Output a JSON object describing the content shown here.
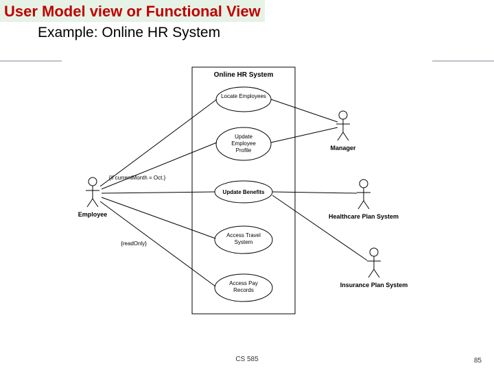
{
  "title": "User Model view or Functional View",
  "subtitle": "Example: Online HR System",
  "footer_course": "CS 585",
  "footer_page": "85",
  "diagram": {
    "system_name": "Online HR System",
    "actors": {
      "employee": "Employee",
      "manager": "Manager",
      "healthcare": "Healthcare Plan System",
      "insurance": "Insurance Plan System"
    },
    "usecases": {
      "uc1": "Locate Employees",
      "uc2_l1": "Update",
      "uc2_l2": "Employee",
      "uc2_l3": "Profile",
      "uc3": "Update Benefits",
      "uc4_l1": "Access Travel",
      "uc4_l2": "System",
      "uc5_l1": "Access Pay",
      "uc5_l2": "Records"
    },
    "notes": {
      "month": "{if currentMonth = Oct.}",
      "readonly": "{readOnly}"
    }
  }
}
